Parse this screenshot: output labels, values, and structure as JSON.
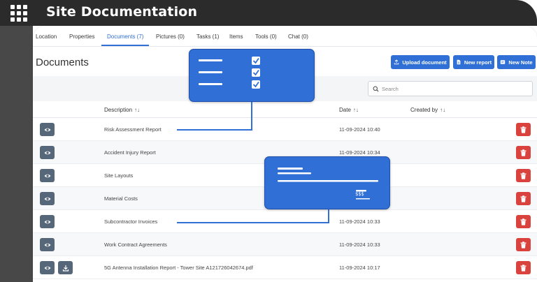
{
  "app": {
    "title": "Site Documentation",
    "menu_icon": "grid-menu-icon"
  },
  "tabs": [
    {
      "label": "Location",
      "active": false
    },
    {
      "label": "Properties",
      "active": false
    },
    {
      "label": "Documents (7)",
      "active": true
    },
    {
      "label": "Pictures (0)",
      "active": false
    },
    {
      "label": "Tasks (1)",
      "active": false
    },
    {
      "label": "Items",
      "active": false
    },
    {
      "label": "Tools (0)",
      "active": false
    },
    {
      "label": "Chat (0)",
      "active": false
    }
  ],
  "page": {
    "title": "Documents"
  },
  "toolbar": {
    "upload_label": "Upload document",
    "new_report_label": "New report",
    "new_note_label": "New Note"
  },
  "search": {
    "placeholder": "Search",
    "value": ""
  },
  "table": {
    "columns": {
      "description": "Description",
      "date": "Date",
      "created_by": "Created by"
    },
    "sort_glyph": "↑↓",
    "rows": [
      {
        "description": "Risk Assessment Report",
        "date": "11-09-2024 10:40",
        "created_by": "",
        "has_download": false
      },
      {
        "description": "Accident Injury Report",
        "date": "11-09-2024 10:34",
        "created_by": "",
        "has_download": false
      },
      {
        "description": "Site Layouts",
        "date": "",
        "created_by": "",
        "has_download": false
      },
      {
        "description": "Material Costs",
        "date": "",
        "created_by": "",
        "has_download": false
      },
      {
        "description": "Subcontractor Invoices",
        "date": "11-09-2024 10:33",
        "created_by": "",
        "has_download": false
      },
      {
        "description": "Work Contract Agreements",
        "date": "11-09-2024 10:33",
        "created_by": "",
        "has_download": false
      },
      {
        "description": "5G Antenna Installation Report - Tower Site A121726042674.pdf",
        "date": "11-09-2024 10:17",
        "created_by": "",
        "has_download": true
      }
    ]
  },
  "callouts": {
    "checklist_icon": "checklist-icon",
    "invoice_icon": "invoice-icon",
    "invoice_amount": "$$$"
  },
  "colors": {
    "primary": "#2f6fd6",
    "danger": "#d9423d",
    "action_gray": "#56677a",
    "topbar": "#2b2b2b",
    "sidebar": "#484848"
  }
}
